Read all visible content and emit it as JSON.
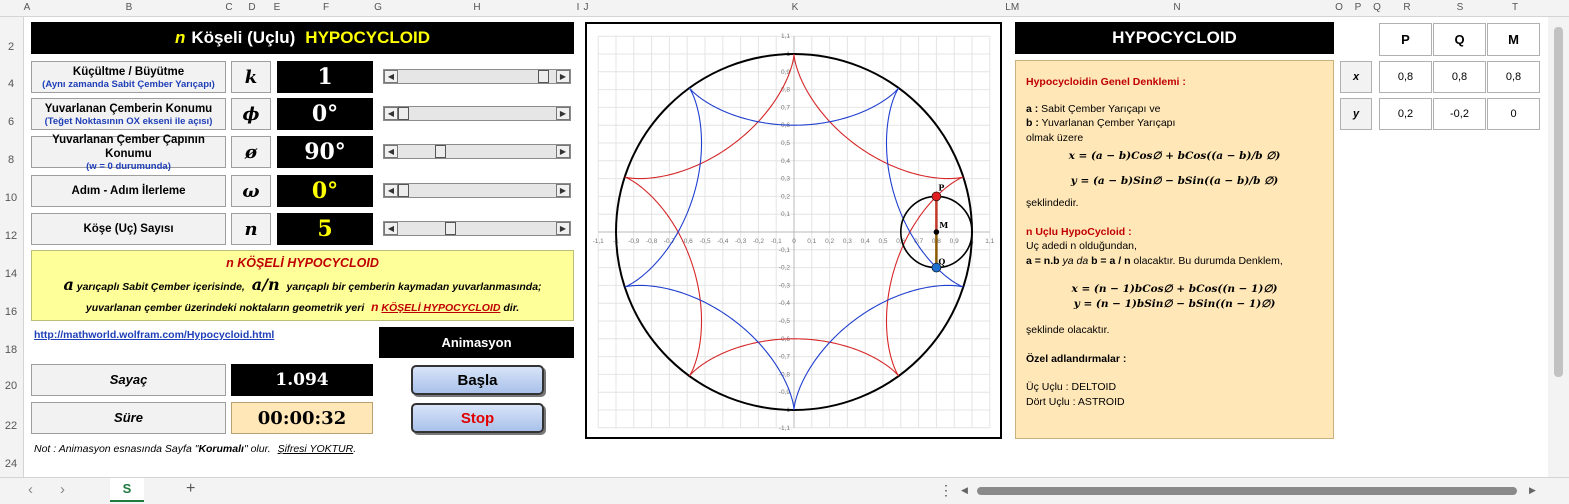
{
  "columns": [
    "A",
    "B",
    "C",
    "D",
    "E",
    "F",
    "G",
    "H",
    "I",
    "J",
    "K",
    "L",
    "M",
    "N",
    "O",
    "P",
    "Q",
    "R",
    "S",
    "T"
  ],
  "rows": [
    "2",
    "4",
    "6",
    "8",
    "10",
    "12",
    "14",
    "16",
    "18",
    "20",
    "22",
    "24"
  ],
  "title": {
    "n": "n",
    "rest": "Köşeli (Uçlu)",
    "hypo": "HYPOCYCLOID"
  },
  "controls": [
    {
      "label": "Küçültme / Büyütme",
      "sub": "(Aynı zamanda Sabit Çember Yarıçapı)",
      "symbol": "k",
      "value": "1",
      "value_color": "#ffffff",
      "thumb": 0.95
    },
    {
      "label": "Yuvarlanan Çemberin Konumu",
      "sub": "(Teğet Noktasının OX ekseni ile açısı)",
      "symbol": "ϕ",
      "value": "0°",
      "value_color": "#ffffff",
      "thumb": 0.0
    },
    {
      "label": "Yuvarlanan Çember Çapının Konumu",
      "sub": "(w = 0  durumunda)",
      "symbol": "ø",
      "value": "90°",
      "value_color": "#ffffff",
      "thumb": 0.25
    },
    {
      "label": "Adım - Adım İlerleme",
      "sub": "",
      "symbol": "ω",
      "value": "0°",
      "value_color": "#ffff00",
      "thumb": 0.0
    },
    {
      "label": "Köşe  (Uç)  Sayısı",
      "sub": "",
      "symbol": "n",
      "value": "5",
      "value_color": "#ffff00",
      "thumb": 0.32
    }
  ],
  "note": {
    "title": "n KÖŞELİ HYPOCYCLOID",
    "line1_a": "a",
    "line1_mid": "yarıçaplı  Sabit Çember içerisinde,",
    "line1_an": "a/n",
    "line1_end": "yarıçaplı bir çemberin kaymadan yuvarlanmasında;",
    "line2_pre": "yuvarlanan çember üzerindeki noktaların geometrik yeri",
    "line2_n": "n",
    "line2_link": "KÖŞELİ  HYPOCYCLOID",
    "line2_end": "dir."
  },
  "link": "http://mathworld.wolfram.com/Hypocycloid.html",
  "animasyon_label": "Animasyon",
  "sayac": {
    "label": "Sayaç",
    "value": "1.094"
  },
  "sure": {
    "label": "Süre",
    "value": "00:00:32"
  },
  "buttons": {
    "start": "Başla",
    "stop": "Stop"
  },
  "footer_note": {
    "pre": "Not : Animasyon esnasında Sayfa \"",
    "bold": "Korumalı",
    "mid": "\" olur.",
    "link": "Şifresi YOKTUR",
    "end": "."
  },
  "chart_data": {
    "type": "line",
    "title": "",
    "xlim": [
      -1.1,
      1.1
    ],
    "ylim": [
      -1.1,
      1.1
    ],
    "ticks": [
      "-1,1",
      "-1",
      "-0,9",
      "-0,8",
      "-0,7",
      "-0,6",
      "-0,5",
      "-0,4",
      "-0,3",
      "-0,2",
      "-0,1",
      "0",
      "0,1",
      "0,2",
      "0,3",
      "0,4",
      "0,5",
      "0,6",
      "0,7",
      "0,8",
      "0,9",
      "1",
      "1,1"
    ],
    "grid": true,
    "fixed_circle_radius": 1,
    "cusps": 5,
    "series": [
      {
        "color": "#d62728",
        "phase_deg": 90
      },
      {
        "color": "#1f3fcf",
        "phase_deg": 270
      }
    ],
    "rolling_circle": {
      "center": [
        0.8,
        0
      ],
      "radius": 0.2
    },
    "points": [
      {
        "label": "P",
        "x": 0.8,
        "y": 0.2,
        "color": "#e02020"
      },
      {
        "label": "Q",
        "x": 0.8,
        "y": -0.2,
        "color": "#1f6fcf"
      },
      {
        "label": "M",
        "x": 0.8,
        "y": 0,
        "color": "#000000"
      }
    ]
  },
  "right_title": "HYPOCYCLOID",
  "explain": {
    "h1": "Hypocycloidin Genel Denklemi :",
    "a_def_b": "a :",
    "a_def": " Sabit Çember Yarıçapı ve",
    "b_def_b": "b :",
    "b_def": " Yuvarlanan Çember Yarıçapı",
    "olmak": "olmak üzere",
    "eq1": "x = (a − b)Cos∅ + bCos((a − b)/b ∅)",
    "eq2": "y = (a − b)Sin∅ − bSin((a − b)/b ∅)",
    "sekl1": "şeklindedir.",
    "h2": "n  Uçlu  HypoCycloid :",
    "uc1": "Uç adedi n olduğundan,",
    "uc2_b": "a = n.b",
    "uc2_m": "  ya da  ",
    "uc2_b2": "b = a / n",
    "uc2_e": "  olacaktır. Bu durumda Denklem,",
    "eq3": "x = (n − 1)bCos∅ + bCos((n − 1)∅)",
    "eq4": "y = (n − 1)bSin∅ − bSin((n − 1)∅)",
    "sekl2": "şeklinde olacaktır.",
    "h3": "Özel adlandırmalar :",
    "s1": "Üç Uçlu : DELTOID",
    "s2": "Dört Uçlu : ASTROID"
  },
  "table": {
    "headers": [
      "P",
      "Q",
      "M"
    ],
    "rows": [
      {
        "label": "x",
        "values": [
          "0,8",
          "0,8",
          "0,8"
        ]
      },
      {
        "label": "y",
        "values": [
          "0,2",
          "-0,2",
          "0"
        ]
      }
    ]
  },
  "sheet_tab": "S",
  "add_sheet": "+"
}
